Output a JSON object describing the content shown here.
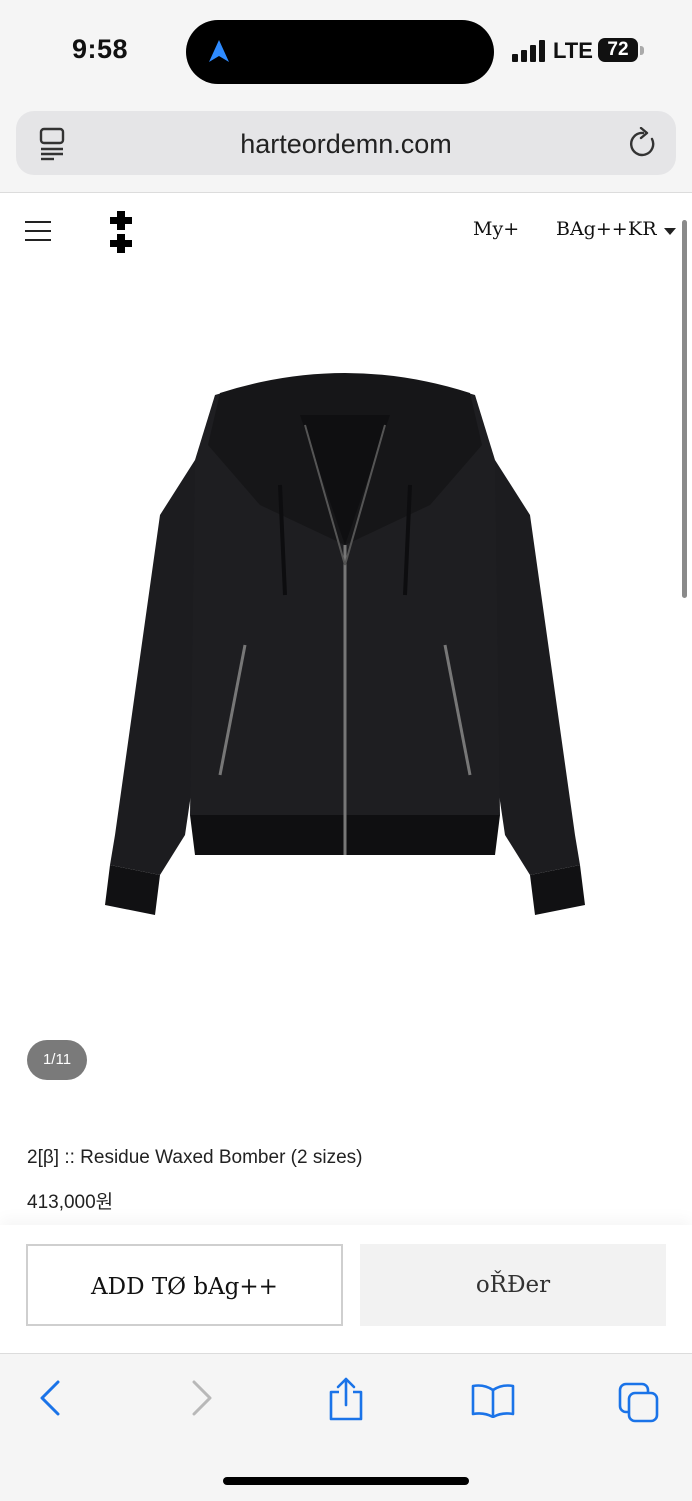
{
  "status_bar": {
    "time": "9:58",
    "network": "LTE",
    "battery": "72"
  },
  "browser": {
    "url": "harteordemn.com"
  },
  "site_nav": {
    "my": "My+",
    "bag": "BAg++",
    "region": "KR"
  },
  "gallery": {
    "pager": "1/11"
  },
  "product": {
    "title": "2[β] :: Residue Waxed Bomber (2 sizes)",
    "price": "413,000원"
  },
  "actions": {
    "add_to_bag": "ADD TØ bAg++",
    "order": "oŘĐer"
  },
  "icons": {
    "location": "location-arrow-icon",
    "reader": "reader-mode-icon",
    "reload": "reload-icon",
    "menu": "hamburger-menu-icon",
    "logo": "double-cross-logo-icon",
    "back": "back-chevron-icon",
    "forward": "forward-chevron-icon",
    "share": "share-icon",
    "bookmarks": "bookmarks-icon",
    "tabs": "tabs-icon"
  },
  "colors": {
    "browser_accent": "#1a73e8",
    "jacket": "#1a1a1c"
  }
}
